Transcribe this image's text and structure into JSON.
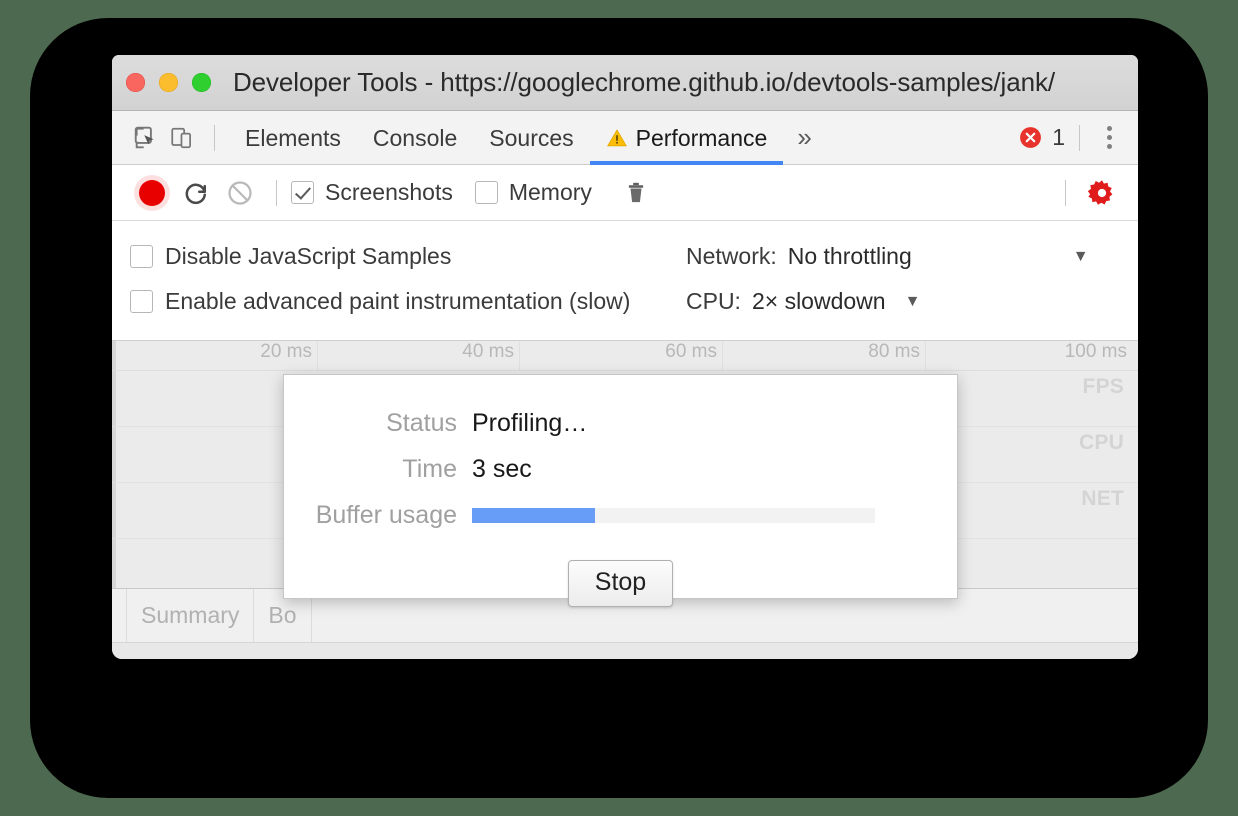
{
  "window": {
    "title": "Developer Tools - https://googlechrome.github.io/devtools-samples/jank/",
    "traffic_lights": [
      "close-button",
      "minimize-button",
      "zoom-button"
    ]
  },
  "devtools": {
    "inspect_icon": "inspect-element-icon",
    "device_icon": "device-toolbar-icon",
    "tabs": [
      {
        "label": "Elements",
        "active": false,
        "warning": false
      },
      {
        "label": "Console",
        "active": false,
        "warning": false
      },
      {
        "label": "Sources",
        "active": false,
        "warning": false
      },
      {
        "label": "Performance",
        "active": true,
        "warning": true
      }
    ],
    "more_tabs_label": "»",
    "error_count": "1",
    "error_icon": "error-circle-icon",
    "kebab_icon": "more-options-icon"
  },
  "record_toolbar": {
    "record_icon": "record-button",
    "reload_icon": "record-and-reload-icon",
    "clear_icon": "clear-recording-icon",
    "screenshots": {
      "label": "Screenshots",
      "checked": true
    },
    "memory": {
      "label": "Memory",
      "checked": false
    },
    "trash_icon": "trash-icon",
    "settings_icon": "settings-gear-icon",
    "settings_color": "#e01b1b"
  },
  "capture_settings": {
    "rows": [
      {
        "checkbox_label": "Disable JavaScript Samples",
        "checked": false,
        "select_key": "Network:",
        "select_value": "No throttling",
        "caret": "▼"
      },
      {
        "checkbox_label": "Enable advanced paint instrumentation (slow)",
        "checked": false,
        "select_key": "CPU:",
        "select_value": "2× slowdown",
        "caret": "▼"
      }
    ]
  },
  "timeline": {
    "ticks": [
      "20 ms",
      "40 ms",
      "60 ms",
      "80 ms",
      "100 ms"
    ],
    "lanes": [
      {
        "label": "FPS",
        "height": 56
      },
      {
        "label": "CPU",
        "height": 56
      },
      {
        "label": "NET",
        "height": 56
      },
      {
        "label": "",
        "height": 48
      }
    ]
  },
  "bottom_tabs": [
    {
      "label": "Summary"
    },
    {
      "label": "Bo"
    }
  ],
  "dialog": {
    "rows": [
      {
        "label": "Status",
        "value": "Profiling…",
        "type": "text"
      },
      {
        "label": "Time",
        "value": "3 sec",
        "type": "text"
      },
      {
        "label": "Buffer usage",
        "value": "",
        "type": "progress",
        "percent": 30.5
      }
    ],
    "stop_label": "Stop",
    "progress_color": "#679df6",
    "progress_track_color": "#f2f2f2"
  }
}
